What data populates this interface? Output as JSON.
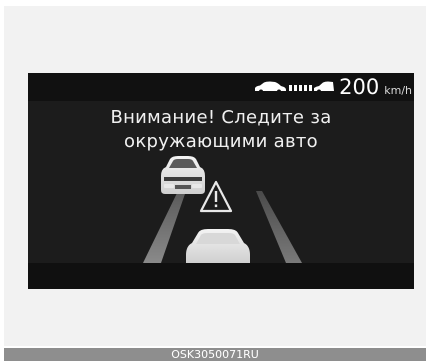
{
  "speed": {
    "value": "200",
    "unit": "km/h"
  },
  "message": {
    "line1": "Внимание! Следите за",
    "line2": "окружающими авто"
  },
  "caption": "OSK3050071RU",
  "icons": {
    "speed_limit": "car-distance-icon",
    "warning": "warning-triangle-icon",
    "own_vehicle": "own-car-icon",
    "lead_vehicle": "lead-car-icon"
  },
  "colors": {
    "cluster_bg": "#1c1c1c",
    "text": "#f0f0f0",
    "caption_bar": "#8e8e8e"
  }
}
